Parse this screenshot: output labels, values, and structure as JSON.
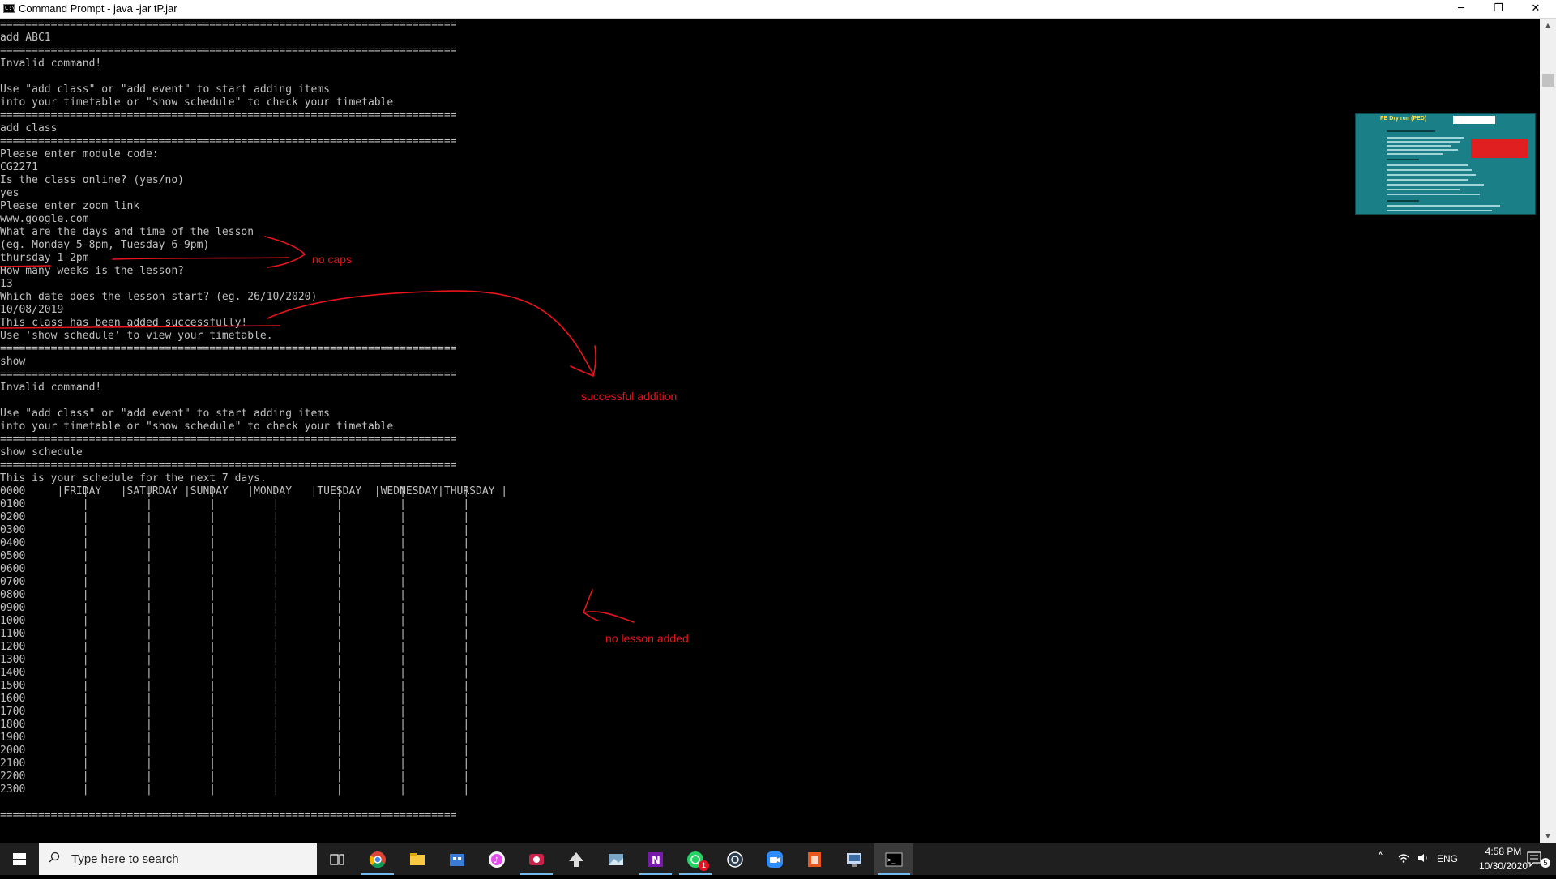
{
  "window": {
    "title": "Command Prompt - java  -jar tP.jar",
    "icon_label": "C:\\",
    "minimize_glyph": "─",
    "maximize_glyph": "❐",
    "close_glyph": "✕"
  },
  "console": {
    "lines": [
      "========================================================================",
      "add ABC1",
      "========================================================================",
      "Invalid command!",
      "",
      "Use \"add class\" or \"add event\" to start adding items",
      "into your timetable or \"show schedule\" to check your timetable",
      "========================================================================",
      "add class",
      "========================================================================",
      "Please enter module code:",
      "CG2271",
      "Is the class online? (yes/no)",
      "yes",
      "Please enter zoom link",
      "www.google.com",
      "What are the days and time of the lesson",
      "(eg. Monday 5-8pm, Tuesday 6-9pm)",
      "thursday 1-2pm",
      "How many weeks is the lesson?",
      "13",
      "Which date does the lesson start? (eg. 26/10/2020)",
      "10/08/2019",
      "This class has been added successfully!",
      "Use 'show schedule' to view your timetable.",
      "========================================================================",
      "show",
      "========================================================================",
      "Invalid command!",
      "",
      "Use \"add class\" or \"add event\" to start adding items",
      "into your timetable or \"show schedule\" to check your timetable",
      "========================================================================",
      "show schedule",
      "========================================================================",
      "This is your schedule for the next 7 days.",
      "         |FRIDAY   |SATURDAY |SUNDAY   |MONDAY   |TUESDAY  |WEDNESDAY|THURSDAY |"
    ],
    "schedule": {
      "times": [
        "0000",
        "0100",
        "0200",
        "0300",
        "0400",
        "0500",
        "0600",
        "0700",
        "0800",
        "0900",
        "1000",
        "1100",
        "1200",
        "1300",
        "1400",
        "1500",
        "1600",
        "1700",
        "1800",
        "1900",
        "2000",
        "2100",
        "2200",
        "2300"
      ],
      "empty_cells": "         |         |         |         |         |         |         |"
    },
    "bottom_separator": "========================================================================"
  },
  "annotations": {
    "no_caps": "no caps",
    "successful_addition": "successful addition",
    "no_lesson_added": "no lesson added",
    "color": "#e8141c"
  },
  "thumbnail": {
    "title": "PE Dry run (PED)"
  },
  "taskbar": {
    "search_placeholder": "Type here to search",
    "apps": [
      "task-view",
      "chrome",
      "file-explorer",
      "store",
      "itunes",
      "screen-recorder",
      "inkscape",
      "photos",
      "onenote",
      "whatsapp",
      "cortana",
      "zoom",
      "office",
      "control-panel",
      "command-prompt"
    ],
    "whatsapp_badge": "1",
    "tray": {
      "language": "ENG",
      "time": "4:58 PM",
      "date": "10/30/2020",
      "notification_count": "5"
    }
  }
}
